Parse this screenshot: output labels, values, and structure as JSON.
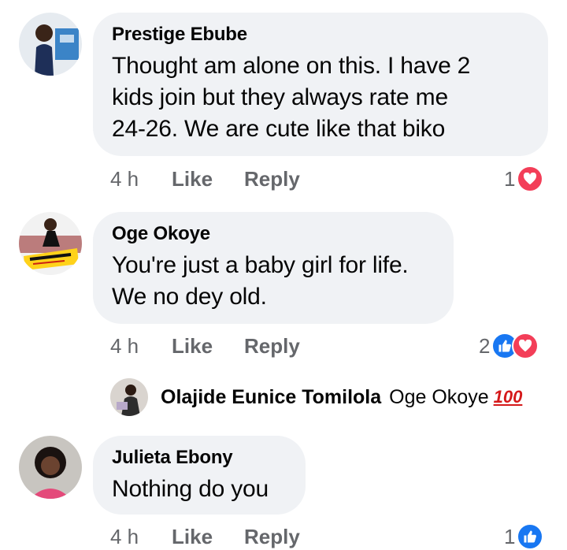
{
  "comments": [
    {
      "author": "Prestige Ebube",
      "text_lines": [
        "Thought am alone on this. I have 2",
        "kids join but they always rate me",
        "24-26. We are cute like that biko"
      ],
      "time": "4 h",
      "like": "Like",
      "reply": "Reply",
      "reaction_count": "1"
    },
    {
      "author": "Oge Okoye",
      "text_lines": [
        "You're just a baby girl for life.",
        "We no dey old."
      ],
      "time": "4 h",
      "like": "Like",
      "reply": "Reply",
      "reaction_count": "2",
      "reply_preview": {
        "author": "Olajide Eunice Tomilola",
        "text": "Oge Okoye",
        "emoji": "100"
      }
    },
    {
      "author": "Julieta Ebony",
      "text_lines": [
        "Nothing do you"
      ],
      "time": "4 h",
      "like": "Like",
      "reply": "Reply",
      "reaction_count": "1"
    }
  ],
  "colors": {
    "bubble": "#f0f2f5",
    "meta": "#65676b",
    "heart": "#f33e58",
    "like": "#1877f2"
  }
}
